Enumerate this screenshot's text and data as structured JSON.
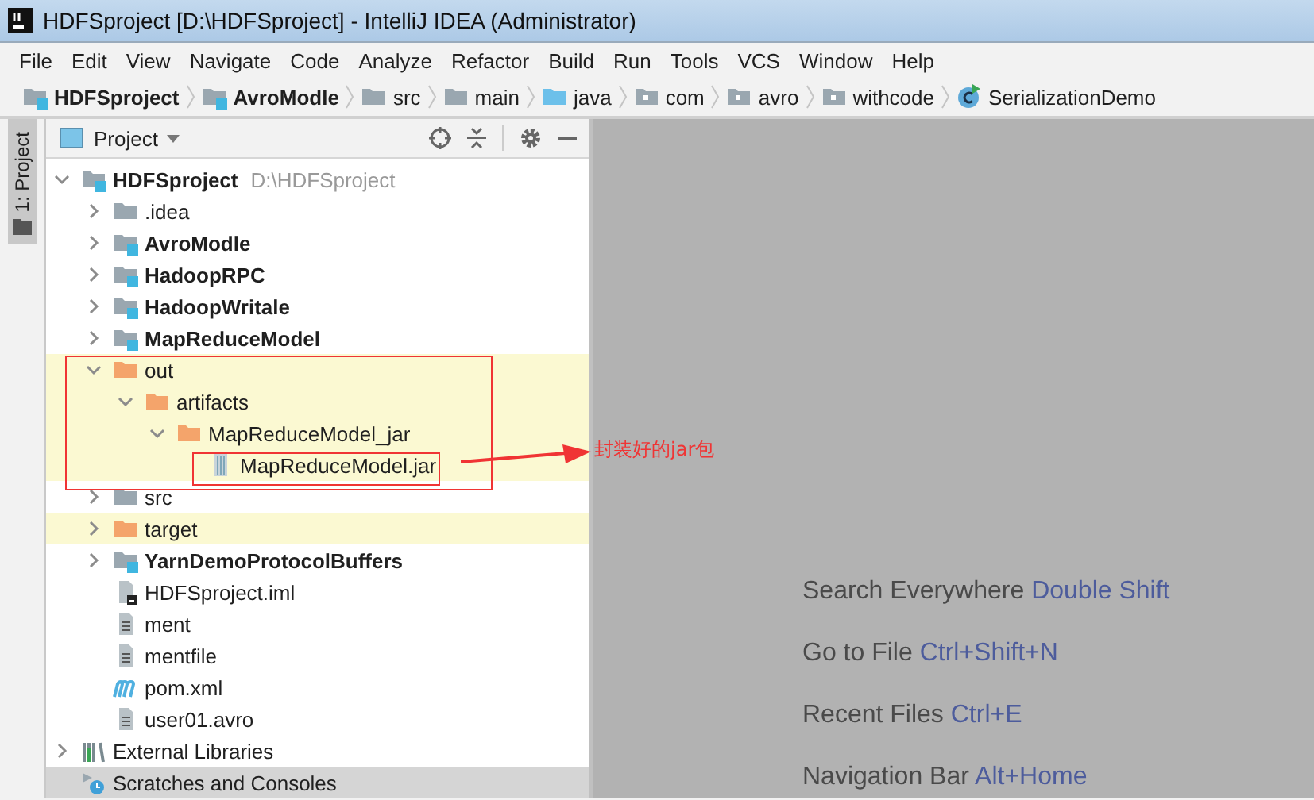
{
  "window": {
    "title": "HDFSproject [D:\\HDFSproject] - IntelliJ IDEA (Administrator)"
  },
  "menu": [
    "File",
    "Edit",
    "View",
    "Navigate",
    "Code",
    "Analyze",
    "Refactor",
    "Build",
    "Run",
    "Tools",
    "VCS",
    "Window",
    "Help"
  ],
  "breadcrumbs": [
    {
      "label": "HDFSproject",
      "kind": "module"
    },
    {
      "label": "AvroModle",
      "kind": "module"
    },
    {
      "label": "src",
      "kind": "folder"
    },
    {
      "label": "main",
      "kind": "folder"
    },
    {
      "label": "java",
      "kind": "source"
    },
    {
      "label": "com",
      "kind": "package"
    },
    {
      "label": "avro",
      "kind": "package"
    },
    {
      "label": "withcode",
      "kind": "package"
    },
    {
      "label": "SerializationDemo",
      "kind": "class"
    }
  ],
  "tool_window_tab": {
    "label": "1: Project",
    "selected": true
  },
  "project_panel": {
    "title": "Project",
    "tree": [
      {
        "label": "HDFSproject",
        "hint": "D:\\HDFSproject",
        "kind": "module",
        "expanded": true,
        "excluded": false,
        "selected": false,
        "children": [
          {
            "label": ".idea",
            "kind": "folder",
            "expanded": false,
            "excluded": false,
            "selected": false
          },
          {
            "label": "AvroModle",
            "kind": "module",
            "expanded": false,
            "excluded": false,
            "selected": false
          },
          {
            "label": "HadoopRPC",
            "kind": "module",
            "expanded": false,
            "excluded": false,
            "selected": false
          },
          {
            "label": "HadoopWritale",
            "kind": "module",
            "expanded": false,
            "excluded": false,
            "selected": false
          },
          {
            "label": "MapReduceModel",
            "kind": "module",
            "expanded": false,
            "excluded": false,
            "selected": false
          },
          {
            "label": "out",
            "kind": "excluded-folder",
            "expanded": true,
            "excluded": true,
            "selected": false,
            "children": [
              {
                "label": "artifacts",
                "kind": "excluded-folder",
                "expanded": true,
                "excluded": true,
                "selected": false,
                "children": [
                  {
                    "label": "MapReduceModel_jar",
                    "kind": "excluded-folder",
                    "expanded": true,
                    "excluded": true,
                    "selected": false,
                    "children": [
                      {
                        "label": "MapReduceModel.jar",
                        "kind": "jar",
                        "excluded": true,
                        "selected": false
                      }
                    ]
                  }
                ]
              }
            ]
          },
          {
            "label": "src",
            "kind": "folder",
            "expanded": false,
            "excluded": false,
            "selected": false
          },
          {
            "label": "target",
            "kind": "excluded-folder",
            "expanded": false,
            "excluded": true,
            "selected": false
          },
          {
            "label": "YarnDemoProtocolBuffers",
            "kind": "module",
            "expanded": false,
            "excluded": false,
            "selected": false
          },
          {
            "label": "HDFSproject.iml",
            "kind": "iml",
            "excluded": false,
            "selected": false
          },
          {
            "label": "ment",
            "kind": "text",
            "excluded": false,
            "selected": false
          },
          {
            "label": "mentfile",
            "kind": "text",
            "excluded": false,
            "selected": false
          },
          {
            "label": "pom.xml",
            "kind": "maven",
            "excluded": false,
            "selected": false
          },
          {
            "label": "user01.avro",
            "kind": "text",
            "excluded": false,
            "selected": false
          }
        ]
      },
      {
        "label": "External Libraries",
        "kind": "libraries",
        "expanded": false,
        "excluded": false,
        "selected": false
      },
      {
        "label": "Scratches and Consoles",
        "kind": "scratches",
        "excluded": false,
        "selected": true
      }
    ]
  },
  "annotation": {
    "text": "封装好的jar包"
  },
  "welcome_hints": [
    {
      "label": "Search Everywhere",
      "shortcut": "Double Shift"
    },
    {
      "label": "Go to File",
      "shortcut": "Ctrl+Shift+N"
    },
    {
      "label": "Recent Files",
      "shortcut": "Ctrl+E"
    },
    {
      "label": "Navigation Bar",
      "shortcut": "Alt+Home"
    }
  ]
}
